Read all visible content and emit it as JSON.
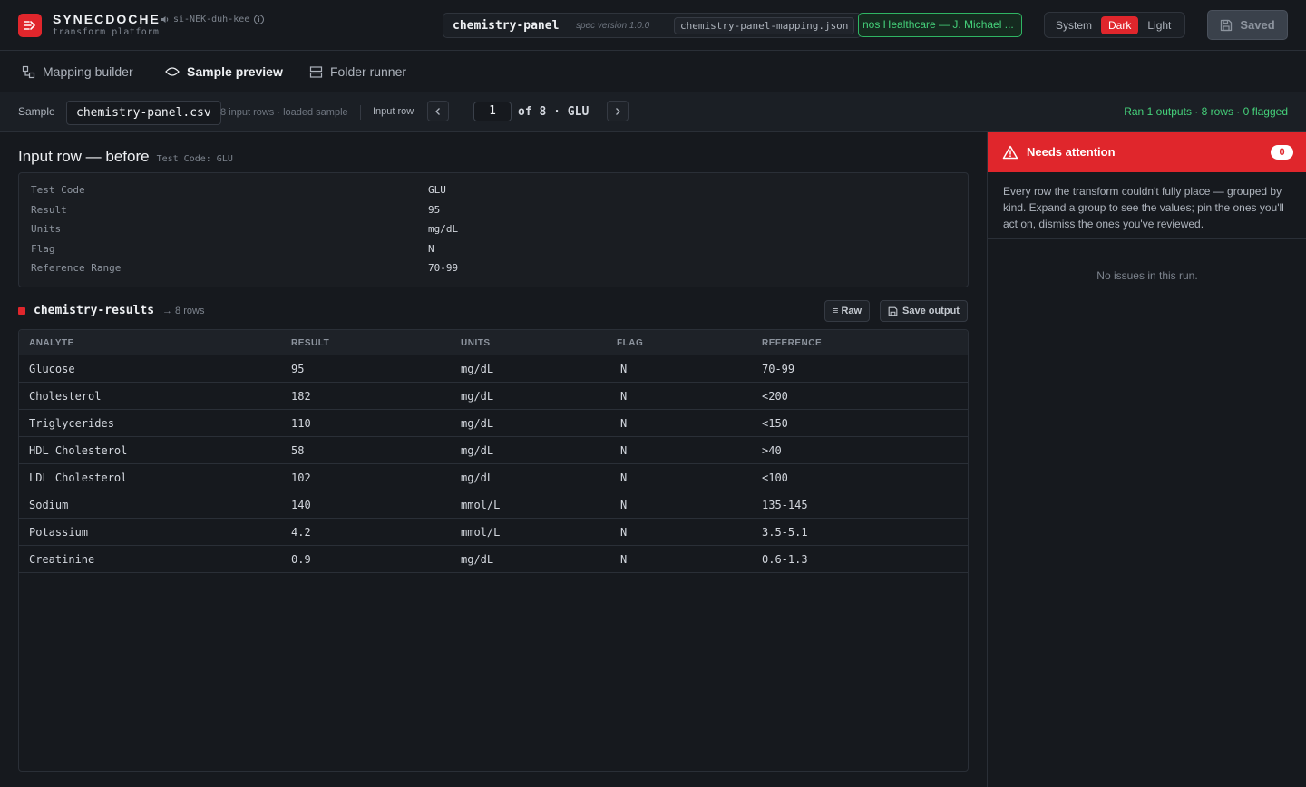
{
  "app": {
    "name": "SYNECDOCHE",
    "subtitle": "transform platform",
    "pronunciation": "si-NEK-duh-kee"
  },
  "spec": {
    "name": "chemistry-panel",
    "version": "spec version 1.0.0",
    "file": "chemistry-panel-mapping.json",
    "org": "nos Healthcare — J. Michael ..."
  },
  "theme": {
    "options": [
      "System",
      "Dark",
      "Light"
    ],
    "selected": "Dark"
  },
  "save": {
    "label": "Saved"
  },
  "tabs": [
    {
      "label": "Mapping builder",
      "icon": "mapping-icon"
    },
    {
      "label": "Sample preview",
      "icon": "eye-icon",
      "active": true
    },
    {
      "label": "Folder runner",
      "icon": "folder-runner-icon"
    }
  ],
  "sample": {
    "label": "Sample",
    "file": "chemistry-panel.csv",
    "meta": "8 input rows · loaded sample",
    "input_row_label": "Input row",
    "row_value": "1",
    "of_text": "of 8 · GLU",
    "status": "Ran 1 outputs · 8 rows · 0 flagged"
  },
  "input": {
    "title": "Input row — before",
    "subtitle": "Test Code: GLU",
    "fields": [
      {
        "key": "Test Code",
        "value": "GLU"
      },
      {
        "key": "Result",
        "value": "95"
      },
      {
        "key": "Units",
        "value": "mg/dL"
      },
      {
        "key": "Flag",
        "value": "N"
      },
      {
        "key": "Reference Range",
        "value": "70-99"
      }
    ]
  },
  "output": {
    "name": "chemistry-results",
    "rows_label": "→ 8 rows",
    "raw_label": "≡ Raw",
    "save_label": "Save output",
    "columns": [
      "ANALYTE",
      "RESULT",
      "UNITS",
      "FLAG",
      "REFERENCE"
    ],
    "rows": [
      [
        "Glucose",
        "95",
        "mg/dL",
        "N",
        "70-99"
      ],
      [
        "Cholesterol",
        "182",
        "mg/dL",
        "N",
        "<200"
      ],
      [
        "Triglycerides",
        "110",
        "mg/dL",
        "N",
        "<150"
      ],
      [
        "HDL Cholesterol",
        "58",
        "mg/dL",
        "N",
        ">40"
      ],
      [
        "LDL Cholesterol",
        "102",
        "mg/dL",
        "N",
        "<100"
      ],
      [
        "Sodium",
        "140",
        "mmol/L",
        "N",
        "135-145"
      ],
      [
        "Potassium",
        "4.2",
        "mmol/L",
        "N",
        "3.5-5.1"
      ],
      [
        "Creatinine",
        "0.9",
        "mg/dL",
        "N",
        "0.6-1.3"
      ]
    ]
  },
  "attention": {
    "title": "Needs attention",
    "count": "0",
    "description": "Every row the transform couldn't fully place — grouped by kind. Expand a group to see the values; pin the ones you'll act on, dismiss the ones you've reviewed.",
    "empty": "No issues in this run."
  },
  "colors": {
    "accent": "#e0262c",
    "success": "#45d07a",
    "bg": "#16191e"
  }
}
